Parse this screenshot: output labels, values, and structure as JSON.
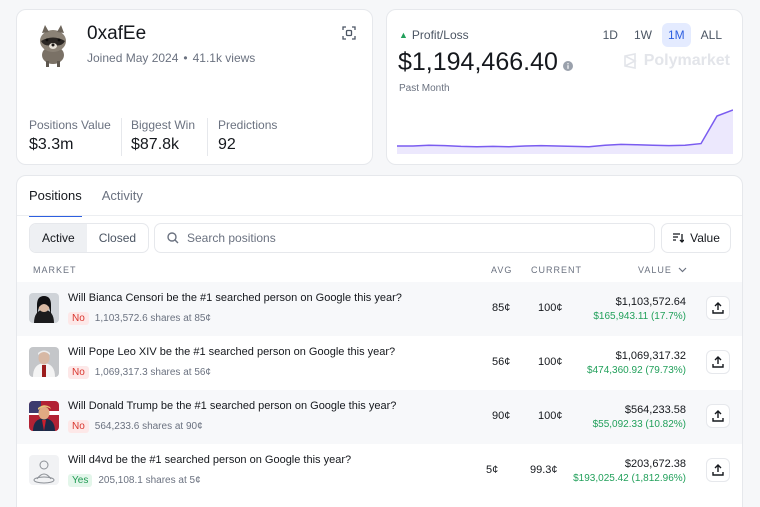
{
  "profile": {
    "username": "0xafEe",
    "joined": "Joined May 2024",
    "views": "41.1k views",
    "stats": [
      {
        "label": "Positions Value",
        "value": "$3.3m"
      },
      {
        "label": "Biggest Win",
        "value": "$87.8k"
      },
      {
        "label": "Predictions",
        "value": "92"
      }
    ]
  },
  "pnl": {
    "label": "Profit/Loss",
    "value": "$1,194,466.40",
    "period_label": "Past Month",
    "periods": [
      "1D",
      "1W",
      "1M",
      "ALL"
    ],
    "active_period": "1M",
    "brand": "Polymarket",
    "line_color": "#7a5cf0",
    "up_color": "#22a05b"
  },
  "chart_data": {
    "type": "line",
    "series": [
      {
        "values": [
          10,
          10,
          12,
          11,
          9,
          8,
          9,
          8,
          10,
          11,
          10,
          9,
          8,
          12,
          14,
          13,
          12,
          11,
          12,
          16,
          85,
          100
        ]
      }
    ],
    "ylim": [
      0,
      110
    ],
    "grid": false,
    "fill": true
  },
  "positions": {
    "tabs": [
      "Positions",
      "Activity"
    ],
    "active_tab": "Positions",
    "filters": [
      "Active",
      "Closed"
    ],
    "active_filter": "Active",
    "search_placeholder": "Search positions",
    "sort_label": "Value",
    "columns": {
      "market": "MARKET",
      "avg": "AVG",
      "current": "CURRENT",
      "value": "VALUE"
    },
    "rows": [
      {
        "title": "Will Bianca Censori be the #1 searched person on Google this year?",
        "outcome": "No",
        "shares": "1,103,572.6 shares at 85¢",
        "avg": "85¢",
        "current": "100¢",
        "value": "$1,103,572.64",
        "pnl": "$165,943.11 (17.7%)"
      },
      {
        "title": "Will Pope Leo XIV be the #1 searched person on Google this year?",
        "outcome": "No",
        "shares": "1,069,317.3 shares at 56¢",
        "avg": "56¢",
        "current": "100¢",
        "value": "$1,069,317.32",
        "pnl": "$474,360.92 (79.73%)"
      },
      {
        "title": "Will Donald Trump be the #1 searched person on Google this year?",
        "outcome": "No",
        "shares": "564,233.6 shares at 90¢",
        "avg": "90¢",
        "current": "100¢",
        "value": "$564,233.58",
        "pnl": "$55,092.33 (10.82%)"
      },
      {
        "title": "Will d4vd be the #1 searched person on Google this year?",
        "outcome": "Yes",
        "shares": "205,108.1 shares at 5¢",
        "avg": "5¢",
        "current": "99.3¢",
        "value": "$203,672.38",
        "pnl": "$193,025.42 (1,812.96%)"
      }
    ]
  }
}
